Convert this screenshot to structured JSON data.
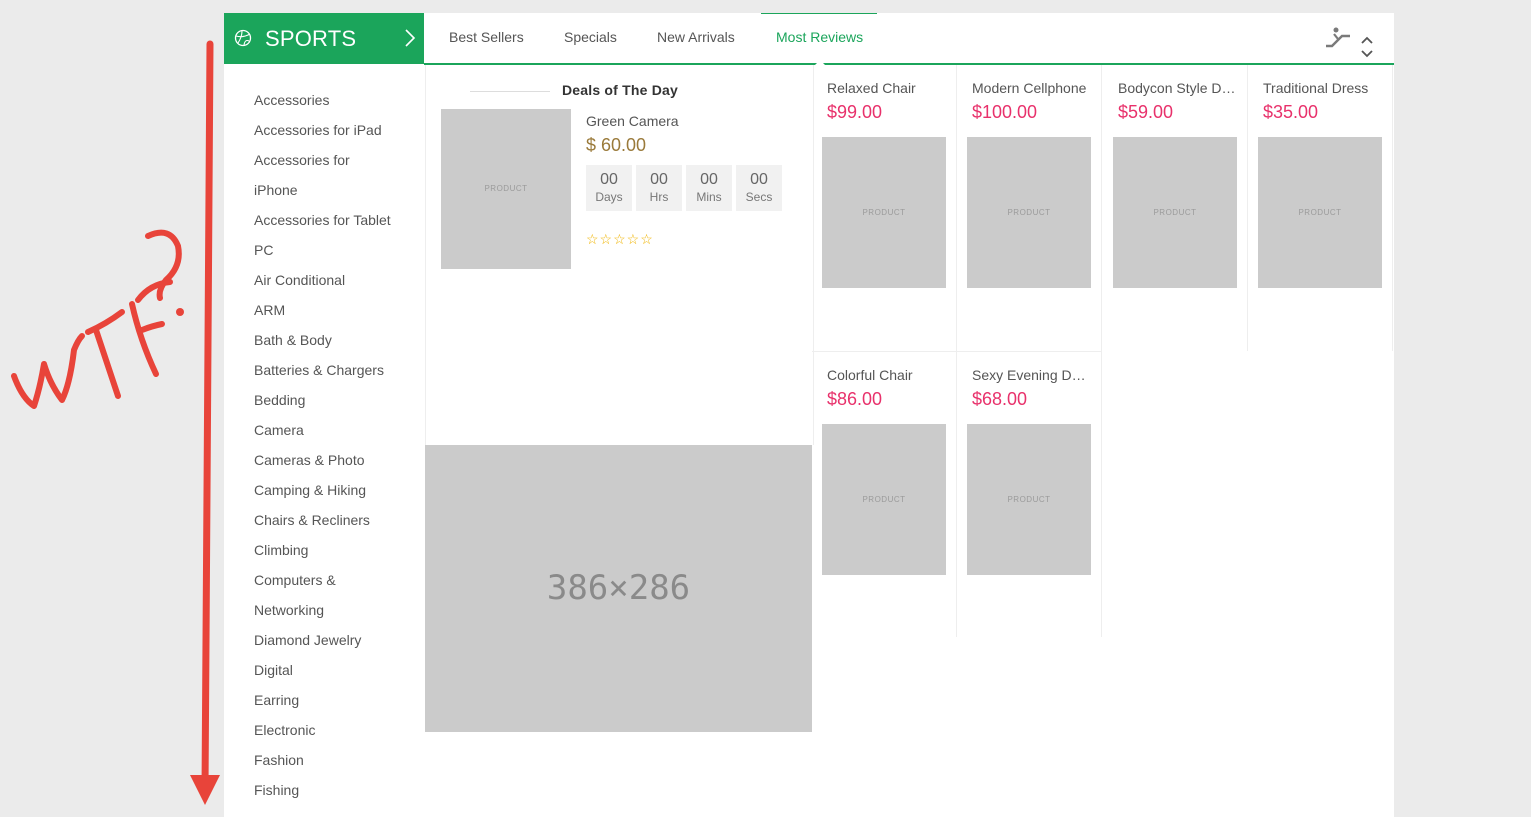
{
  "header": {
    "category_title": "SPORTS",
    "tabs": [
      {
        "label": "Best Sellers"
      },
      {
        "label": "Specials"
      },
      {
        "label": "New Arrivals"
      },
      {
        "label": "Most Reviews"
      }
    ],
    "active_tab": "Most Reviews"
  },
  "sidebar": {
    "items": [
      "Accessories",
      "Accessories for iPad",
      "Accessories for",
      "iPhone",
      "Accessories for Tablet",
      "PC",
      "Air Conditional",
      "ARM",
      "Bath & Body",
      "Batteries & Chargers",
      "Bedding",
      "Camera",
      "Cameras & Photo",
      "Camping & Hiking",
      "Chairs & Recliners",
      "Climbing",
      "Computers &",
      "Networking",
      "Diamond Jewelry",
      "Digital",
      "Earring",
      "Electronic",
      "Fashion",
      "Fishing"
    ]
  },
  "deals": {
    "title": "Deals of The Day",
    "image_label": "PRODUCT",
    "product_name": "Green Camera",
    "price": "$  60.00",
    "countdown": [
      {
        "value": "00",
        "unit": "Days"
      },
      {
        "value": "00",
        "unit": "Hrs"
      },
      {
        "value": "00",
        "unit": "Mins"
      },
      {
        "value": "00",
        "unit": "Secs"
      }
    ],
    "rating_stars": "☆☆☆☆☆"
  },
  "banner": {
    "label": "386×286"
  },
  "products": [
    {
      "name": "Relaxed Chair",
      "price": "$99.00",
      "image_label": "PRODUCT"
    },
    {
      "name": "Modern Cellphone",
      "price": "$100.00",
      "image_label": "PRODUCT"
    },
    {
      "name": "Bodycon Style Dress",
      "price": "$59.00",
      "image_label": "PRODUCT"
    },
    {
      "name": "Traditional Dress",
      "price": "$35.00",
      "image_label": "PRODUCT"
    },
    {
      "name": "Colorful Chair",
      "price": "$86.00",
      "image_label": "PRODUCT"
    },
    {
      "name": "Sexy Evening Dress",
      "price": "$68.00",
      "image_label": "PRODUCT"
    }
  ],
  "annotation": {
    "text": "wtf?",
    "color": "#e8443a"
  },
  "colors": {
    "brand_green": "#1ba55b",
    "price_pink": "#e8316b",
    "deal_price": "#9a7a3a",
    "placeholder": "#cbcbcb"
  }
}
